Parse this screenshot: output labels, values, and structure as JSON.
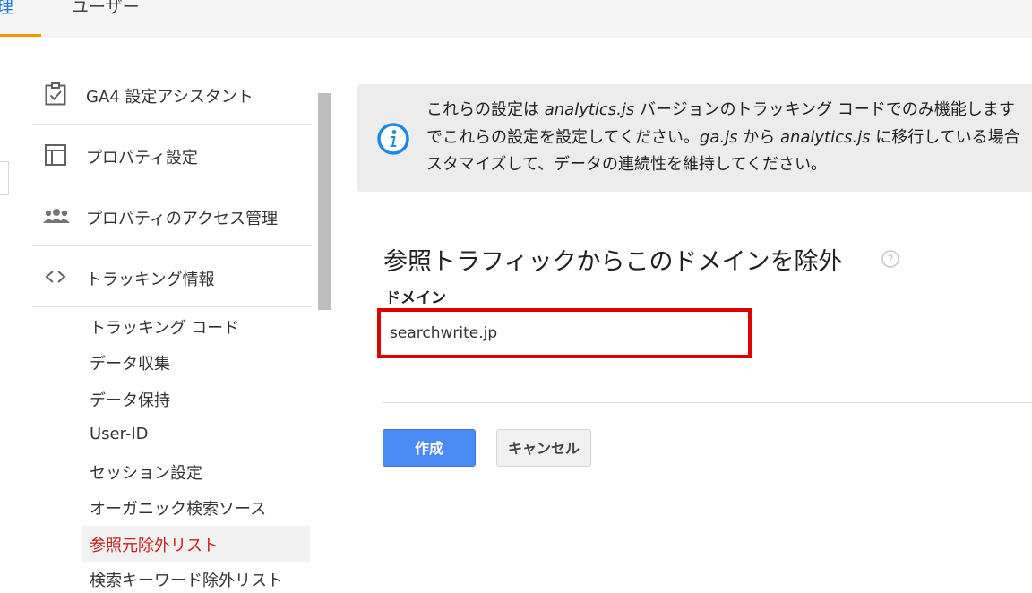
{
  "tabs": {
    "admin": "理",
    "user": "ユーザー"
  },
  "sidebar": {
    "items": [
      {
        "label": "GA4 設定アシスタント",
        "icon": "clipboard-check-icon"
      },
      {
        "label": "プロパティ設定",
        "icon": "layout-icon"
      },
      {
        "label": "プロパティのアクセス管理",
        "icon": "people-icon"
      },
      {
        "label": "トラッキング情報",
        "icon": "code-icon"
      }
    ],
    "sub_items": [
      "トラッキング コード",
      "データ収集",
      "データ保持",
      "User-ID",
      "セッション設定",
      "オーガニック検索ソース",
      "参照元除外リスト",
      "検索キーワード除外リスト"
    ]
  },
  "info": {
    "line1_a": "これらの設定は ",
    "line1_b": "analytics.js",
    "line1_c": " バージョンのトラッキング コードでのみ機能します",
    "line2_a": "でこれらの設定を設定してください。",
    "line2_b": "ga.js",
    "line2_c": " から ",
    "line2_d": "analytics.js",
    "line2_e": " に移行している場合",
    "line3": "スタマイズして、データの連続性を維持してください。"
  },
  "form": {
    "title": "参照トラフィックからこのドメインを除外",
    "domain_label": "ドメイン",
    "domain_value": "searchwrite.jp",
    "create_label": "作成",
    "cancel_label": "キャンセル"
  },
  "colors": {
    "accent_blue": "#4a8af4",
    "highlight_red": "#e00000",
    "active_item": "#c5221f",
    "tab_underline": "#f29900"
  }
}
